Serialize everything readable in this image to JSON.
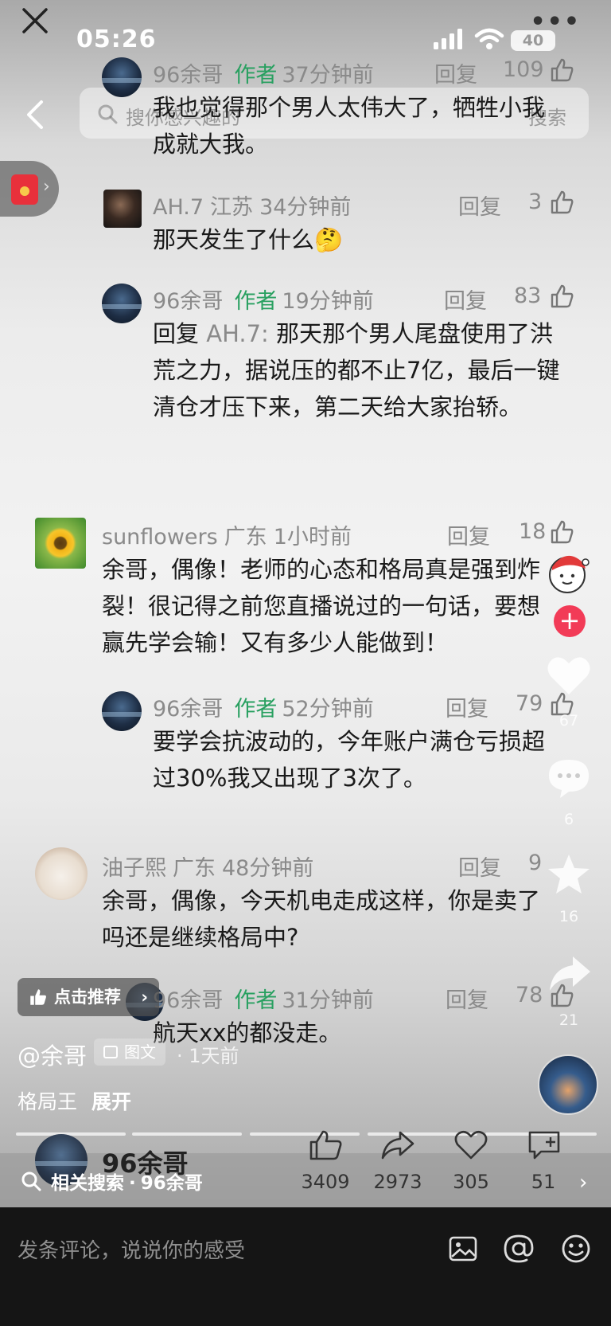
{
  "status": {
    "time": "05:26",
    "battery": "40"
  },
  "search": {
    "placeholder": "搜你感兴趣的",
    "button": "搜索"
  },
  "comments": [
    {
      "name": "96余哥",
      "author_tag": "作者",
      "time": "37分钟前",
      "reply": "回复",
      "likes": "109",
      "text": "我也觉得那个男人太伟大了，牺牲小我成就大我。"
    },
    {
      "name": "AH.7",
      "region": "江苏",
      "time": "34分钟前",
      "reply": "回复",
      "likes": "3",
      "text": "那天发生了什么🤔"
    },
    {
      "name": "96余哥",
      "author_tag": "作者",
      "time": "19分钟前",
      "reply": "回复",
      "likes": "83",
      "reply_prefix": "回复",
      "reply_target": "AH.7:",
      "text": "那天那个男人尾盘使用了洪荒之力，据说压的都不止7亿，最后一键清仓才压下来，第二天给大家抬轿。"
    },
    {
      "name": "sunflowers",
      "region": "广东",
      "time": "1小时前",
      "reply": "回复",
      "likes": "18",
      "text": "余哥，偶像！老师的心态和格局真是强到炸裂！很记得之前您直播说过的一句话，要想赢先学会输！又有多少人能做到！"
    },
    {
      "name": "96余哥",
      "author_tag": "作者",
      "time": "52分钟前",
      "reply": "回复",
      "likes": "79",
      "text": "要学会抗波动的，今年账户满仓亏损超过30%我又出现了3次了。"
    },
    {
      "name": "油子熙",
      "region": "广东",
      "time": "48分钟前",
      "reply": "回复",
      "likes": "9",
      "text": "余哥，偶像，今天机电走成这样，你是卖了吗还是继续格局中?"
    },
    {
      "name": "96余哥",
      "author_tag": "作者",
      "time": "31分钟前",
      "reply": "回复",
      "likes": "78",
      "text": "航天xx的都没走。"
    }
  ],
  "side": {
    "likes": "67",
    "comments": "6",
    "favorites": "16",
    "shares": "21"
  },
  "post": {
    "recommend": "点击推荐",
    "handle": "@余哥",
    "type": "图文",
    "time": "· 1天前",
    "caption": "格局王",
    "expand": "展开"
  },
  "footer": {
    "related_label": "相关搜索",
    "related_sep": "·",
    "related_query": "96余哥",
    "name": "96余哥",
    "stats": {
      "likes": "3409",
      "shares": "2973",
      "favorites": "305",
      "comments": "51"
    },
    "comment_placeholder": "发条评论，说说你的感受"
  },
  "colors": {
    "author": "#28a060",
    "accent": "#f23b57",
    "bar": "#151515"
  }
}
